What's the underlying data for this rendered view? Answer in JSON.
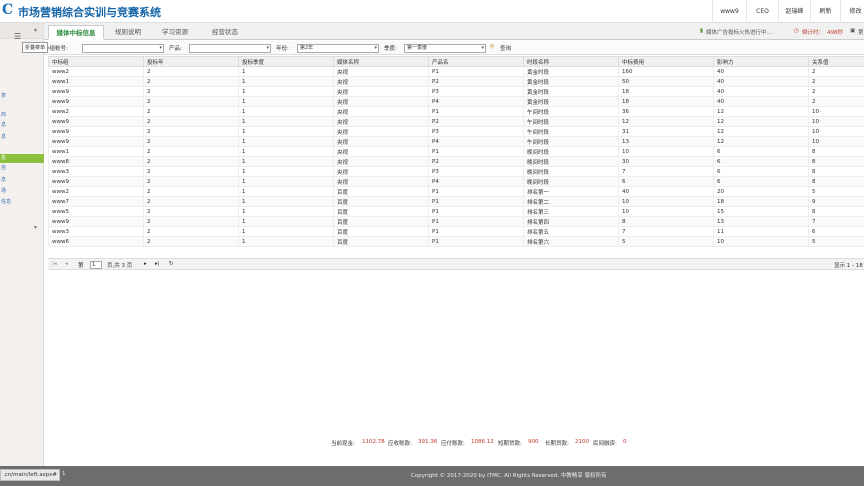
{
  "app": {
    "logo_glyph": "C",
    "title": "市场营销综合实训与竞赛系统"
  },
  "header": {
    "user": "www9",
    "role": "CEO",
    "teacher": "赵瑞峰",
    "refresh": "刷新",
    "modify": "修改"
  },
  "sidebar": {
    "menu_icon": "hamburger-icon",
    "tooltip": "折叠菜单",
    "items": [
      "茶",
      "",
      "商",
      "息",
      "息",
      "息",
      "信",
      "息",
      "场",
      "信息",
      "信息"
    ],
    "active_index": 5
  },
  "tabs": [
    {
      "label": "媒体中标信息",
      "active": true
    },
    {
      "label": "规则说明",
      "active": false
    },
    {
      "label": "学习资源",
      "active": false
    },
    {
      "label": "经营状态",
      "active": false
    }
  ],
  "notice": {
    "text": "媒体广告投标火热进行中...",
    "timer_label": "倒计时：",
    "timer_value": "498秒",
    "right_cut": "第"
  },
  "filters": {
    "account_label": "小组帐号:",
    "account_value": "",
    "product_label": "产品:",
    "product_value": "",
    "year_label": "年份:",
    "year_value": "第2年",
    "quarter_label": "季度:",
    "quarter_value": "第一季度",
    "query_label": "查询"
  },
  "table": {
    "columns": [
      "中标组",
      "投标年",
      "投标季度",
      "媒体名称",
      "产品名",
      "时段名称",
      "中标费用",
      "影响力",
      "关系值"
    ],
    "rows": [
      [
        "www2",
        "2",
        "1",
        "央视",
        "P1",
        "黄金时段",
        "160",
        "40",
        "2"
      ],
      [
        "www1",
        "2",
        "1",
        "央视",
        "P2",
        "黄金时段",
        "50",
        "40",
        "2"
      ],
      [
        "www9",
        "2",
        "1",
        "央视",
        "P3",
        "黄金时段",
        "18",
        "40",
        "2"
      ],
      [
        "www9",
        "2",
        "1",
        "央视",
        "P4",
        "黄金时段",
        "18",
        "40",
        "2"
      ],
      [
        "www2",
        "2",
        "1",
        "央视",
        "P1",
        "午间时段",
        "36",
        "12",
        "10"
      ],
      [
        "www9",
        "2",
        "1",
        "央视",
        "P2",
        "午间时段",
        "12",
        "12",
        "10"
      ],
      [
        "www9",
        "2",
        "1",
        "央视",
        "P3",
        "午间时段",
        "31",
        "12",
        "10"
      ],
      [
        "www9",
        "2",
        "1",
        "央视",
        "P4",
        "午间时段",
        "13",
        "12",
        "10"
      ],
      [
        "www1",
        "2",
        "1",
        "央视",
        "P1",
        "晚间时段",
        "10",
        "6",
        "8"
      ],
      [
        "www8",
        "2",
        "1",
        "央视",
        "P2",
        "晚间时段",
        "30",
        "6",
        "8"
      ],
      [
        "www3",
        "2",
        "1",
        "央视",
        "P3",
        "晚间时段",
        "7",
        "6",
        "8"
      ],
      [
        "www9",
        "2",
        "1",
        "央视",
        "P4",
        "晚间时段",
        "6",
        "6",
        "8"
      ],
      [
        "www2",
        "2",
        "1",
        "百度",
        "P1",
        "排名第一",
        "40",
        "20",
        "5"
      ],
      [
        "www7",
        "2",
        "1",
        "百度",
        "P1",
        "排名第二",
        "10",
        "18",
        "9"
      ],
      [
        "www5",
        "2",
        "1",
        "百度",
        "P1",
        "排名第三",
        "10",
        "15",
        "8"
      ],
      [
        "www9",
        "2",
        "1",
        "百度",
        "P1",
        "排名第四",
        "8",
        "13",
        "7"
      ],
      [
        "www3",
        "2",
        "1",
        "百度",
        "P1",
        "排名第五",
        "7",
        "11",
        "6"
      ],
      [
        "www6",
        "2",
        "1",
        "百度",
        "P1",
        "排名第六",
        "5",
        "10",
        "5"
      ]
    ]
  },
  "pager": {
    "page_prefix": "第",
    "page_value": "1",
    "page_suffix": "页,共 3 页",
    "display": "显示 1 - 18"
  },
  "status_bar": {
    "items": [
      {
        "label": "当前现金:",
        "value": "1102.78"
      },
      {
        "label": "应收账款:",
        "value": "391.36"
      },
      {
        "label": "应付账款:",
        "value": "1086.12"
      },
      {
        "label": "短期贷款:",
        "value": "900"
      },
      {
        "label": "长期贷款:",
        "value": "2100"
      },
      {
        "label": "民间融资:",
        "value": "0"
      }
    ]
  },
  "footer": {
    "copyright": "Copyright © 2017-2020 by ITMC. All Rights Reserved. 中教畅享 版权所有",
    "url": ".cn/main/left.aspx#",
    "left_cut": "1"
  }
}
